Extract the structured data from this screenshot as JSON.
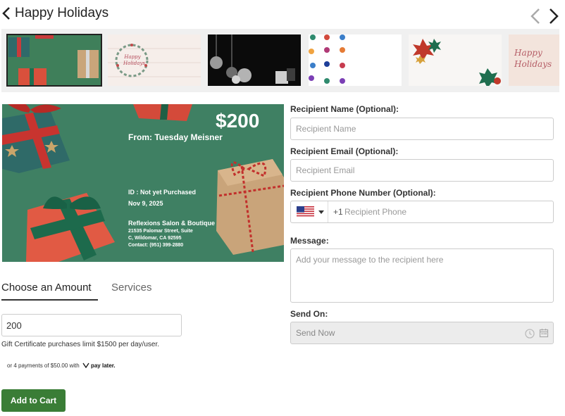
{
  "header": {
    "title": "Happy Holidays",
    "back_icon": "chevron-left-icon",
    "prev_icon": "chevron-left-icon",
    "next_icon": "chevron-right-icon"
  },
  "thumbnails": [
    {
      "label": "",
      "selected": true,
      "description_icon": "gift-boxes-green"
    },
    {
      "label": "Happy Holidays",
      "selected": false,
      "description_icon": "wreath"
    },
    {
      "label": "",
      "selected": false,
      "description_icon": "ornaments-black"
    },
    {
      "label": "",
      "selected": false,
      "description_icon": "hanging-ornaments"
    },
    {
      "label": "",
      "selected": false,
      "description_icon": "bows"
    },
    {
      "label": "Happy Holidays",
      "selected": false,
      "description_icon": "pink-card"
    }
  ],
  "card": {
    "amount": "$200",
    "from": "From: Tuesday Meisner",
    "id": "ID : Not yet Purchased",
    "date": "Nov 9, 2025",
    "business": "Reflexions Salon & Boutique",
    "address_line1": "21535 Palomar Street, Suite",
    "address_line2": "C, Wildomar, CA 92595",
    "contact": "Contact: (951) 399-2880"
  },
  "tabs": {
    "amount": "Choose an Amount",
    "services": "Services"
  },
  "amount": {
    "value": "200",
    "limit_note": "Gift Certificate purchases limit $1500 per day/user.",
    "paylater_text": "or 4 payments of $50.00 with",
    "paylater_brand": "pay later."
  },
  "add_to_cart": "Add to Cart",
  "form": {
    "name_label": "Recipient Name (Optional):",
    "name_placeholder": "Recipient Name",
    "email_label": "Recipient Email (Optional):",
    "email_placeholder": "Recipient Email",
    "phone_label": "Recipient Phone Number (Optional):",
    "dial_code": "+1",
    "phone_placeholder": "Recipient Phone",
    "message_label": "Message:",
    "message_placeholder": "Add your message to the recipient here",
    "send_on_label": "Send On:",
    "send_on_value": "Send Now"
  },
  "colors": {
    "accent_green": "#3a7d36",
    "card_green": "#3f8063"
  }
}
